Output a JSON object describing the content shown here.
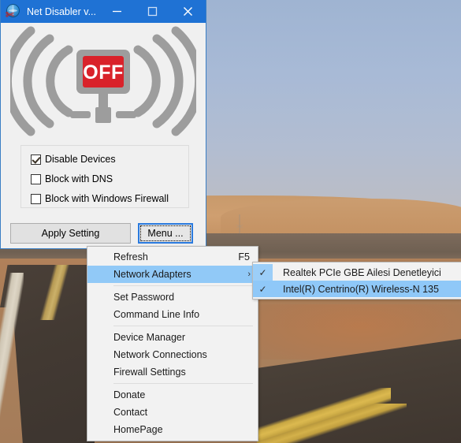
{
  "window": {
    "title": "Net Disabler v...",
    "icon": "globe-scissors-icon",
    "minimize_label": "–",
    "maximize_label": "□",
    "close_label": "✕"
  },
  "hero": {
    "badge_text": "OFF",
    "badge_color": "#d9222a",
    "signal_color": "#9d9d9d"
  },
  "options": [
    {
      "label": "Disable Devices",
      "checked": true
    },
    {
      "label": "Block with DNS",
      "checked": false
    },
    {
      "label": "Block with Windows Firewall",
      "checked": false
    }
  ],
  "buttons": {
    "apply": "Apply Setting",
    "menu": "Menu ..."
  },
  "menu": {
    "items": [
      {
        "label": "Refresh",
        "accel": "F5",
        "selected": false,
        "submenu": false
      },
      {
        "label": "Network Adapters",
        "accel": "",
        "selected": true,
        "submenu": true
      },
      {
        "separator": true
      },
      {
        "label": "Set Password",
        "accel": "",
        "selected": false,
        "submenu": false
      },
      {
        "label": "Command Line Info",
        "accel": "",
        "selected": false,
        "submenu": false
      },
      {
        "separator": true
      },
      {
        "label": "Device Manager",
        "accel": "",
        "selected": false,
        "submenu": false
      },
      {
        "label": "Network Connections",
        "accel": "",
        "selected": false,
        "submenu": false
      },
      {
        "label": "Firewall Settings",
        "accel": "",
        "selected": false,
        "submenu": false
      },
      {
        "separator": true
      },
      {
        "label": "Donate",
        "accel": "",
        "selected": false,
        "submenu": false
      },
      {
        "label": "Contact",
        "accel": "",
        "selected": false,
        "submenu": false
      },
      {
        "label": "HomePage",
        "accel": "",
        "selected": false,
        "submenu": false
      }
    ],
    "submenu_arrow": "›"
  },
  "submenu": {
    "items": [
      {
        "label": "Realtek PCIe GBE Ailesi Denetleyici",
        "checked": true,
        "highlighted": false
      },
      {
        "label": "Intel(R) Centrino(R) Wireless-N 135",
        "checked": true,
        "highlighted": true
      }
    ],
    "check_glyph": "✓"
  },
  "colors": {
    "titlebar": "#1f72d4",
    "window_bg": "#f0f0f0",
    "menu_bg": "#f2f2f2",
    "highlight": "#91c9f7",
    "focus_border": "#2a7ade"
  }
}
